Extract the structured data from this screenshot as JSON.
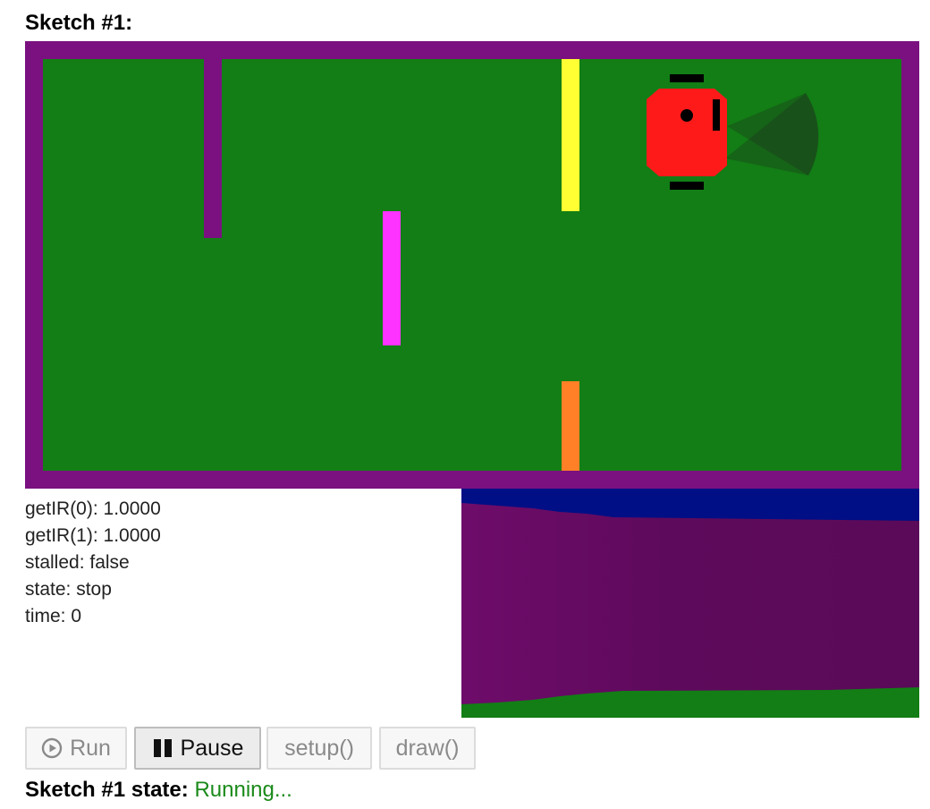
{
  "sketch": {
    "title": "Sketch #1:",
    "state_label": "Sketch #1 state:",
    "state_value": "Running..."
  },
  "colors": {
    "wall": "#7b1180",
    "floor": "#127e15",
    "robot": "#ff1a1a",
    "obstacle_yellow": "#ffff33",
    "obstacle_magenta": "#ff33ff",
    "obstacle_orange": "#ff8026",
    "sky": "#000f85",
    "status_running": "#1a8a1a"
  },
  "readouts": [
    "getIR(0): 1.0000",
    "getIR(1): 1.0000",
    "stalled: false",
    "state: stop",
    "time: 0"
  ],
  "controls": {
    "run_label": "Run",
    "pause_label": "Pause",
    "setup_label": "setup()",
    "draw_label": "draw()",
    "run_icon": "play-circle-icon",
    "pause_icon": "pause-icon"
  }
}
